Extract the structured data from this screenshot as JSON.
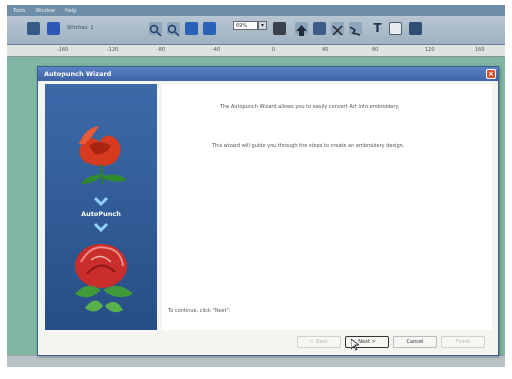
{
  "menu": [
    "Tools",
    "Window",
    "Help"
  ],
  "toolbar": {
    "stitches_label": "Stitches: 1",
    "zoom_value": "69%"
  },
  "ruler_ticks": [
    "-160",
    "-120",
    "-80",
    "-40",
    "0",
    "40",
    "80",
    "120",
    "160"
  ],
  "dialog": {
    "title": "Autopunch Wizard",
    "side_label": "AutoPunch",
    "line1": "The Autopunch Wizard allows you to easily convert Art into embroidery.",
    "line2": "This wizard will guide you through the steps to create an embroidery design.",
    "footer": "To continue, click \"Next\".",
    "buttons": {
      "back": "< Back",
      "next": "Next >",
      "cancel": "Cancel",
      "finish": "Finish"
    }
  },
  "colors": {
    "title_bar": "#4a70b4",
    "side_panel": "#2f5a94",
    "canvas": "#7fb7a3",
    "rose": "#d63b1f"
  }
}
